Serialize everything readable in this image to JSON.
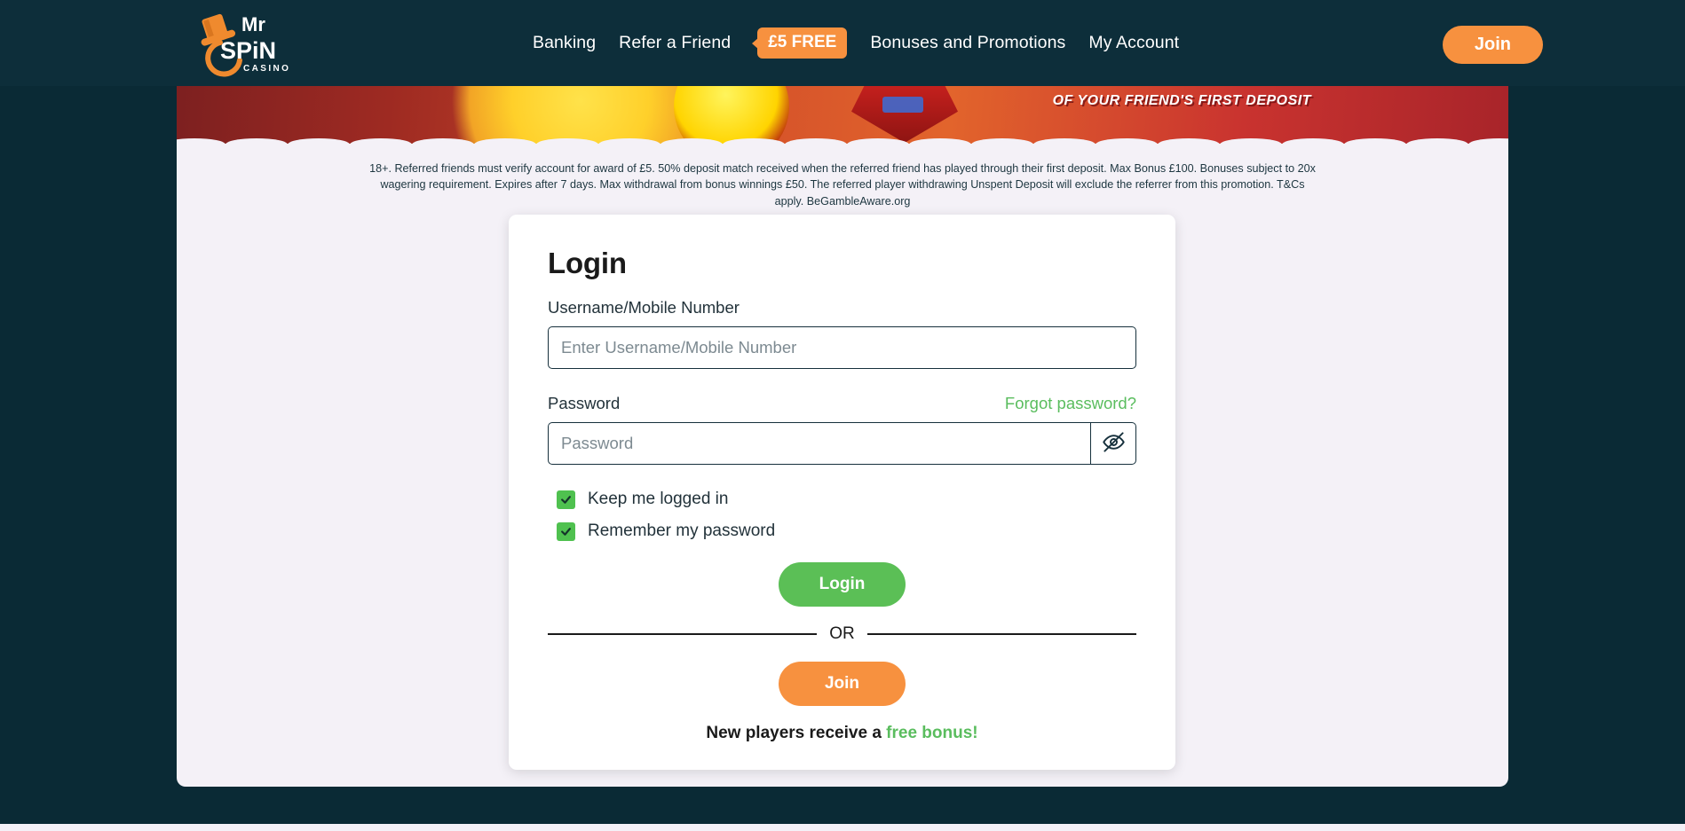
{
  "header": {
    "logo": {
      "line1": "Mr",
      "line2": "SPiN",
      "line3": "CASINO"
    },
    "nav": [
      {
        "label": "Banking",
        "name": "nav-banking"
      },
      {
        "label": "Refer a Friend",
        "name": "nav-refer-a-friend"
      },
      {
        "label": "Bonuses and Promotions",
        "name": "nav-bonuses-and-promotions"
      },
      {
        "label": "My Account",
        "name": "nav-my-account"
      }
    ],
    "badge": "£5 FREE",
    "join_label": "Join"
  },
  "banner": {
    "text": "OF YOUR FRIEND'S FIRST DEPOSIT"
  },
  "disclaimer": "18+. Referred friends must verify account for award of £5. 50% deposit match received when the referred friend has played through their first deposit. Max Bonus £100. Bonuses subject to 20x wagering requirement. Expires after 7 days. Max withdrawal from bonus winnings £50. The referred player withdrawing Unspent Deposit will exclude the referrer from this promotion. T&Cs apply. BeGambleAware.org",
  "login": {
    "title": "Login",
    "username_label": "Username/Mobile Number",
    "username_placeholder": "Enter Username/Mobile Number",
    "username_value": "",
    "password_label": "Password",
    "password_placeholder": "Password",
    "password_value": "",
    "forgot_label": "Forgot password?",
    "toggle_password_icon": "eye-off-icon",
    "keep_logged_in_label": "Keep me logged in",
    "keep_logged_in_checked": true,
    "remember_password_label": "Remember my password",
    "remember_password_checked": true,
    "login_button": "Login",
    "or_label": "OR",
    "join_button": "Join",
    "new_players_prefix": "New players receive a ",
    "new_players_highlight": "free bonus!"
  },
  "colors": {
    "header_bg": "#0d2e3a",
    "page_bg": "#0a2a35",
    "panel_bg": "#f4f1f7",
    "accent_orange": "#f7913f",
    "accent_green": "#5bbf56",
    "link_green": "#5abd5e",
    "checkbox_green": "#4fc14f",
    "input_border": "#16303c"
  }
}
